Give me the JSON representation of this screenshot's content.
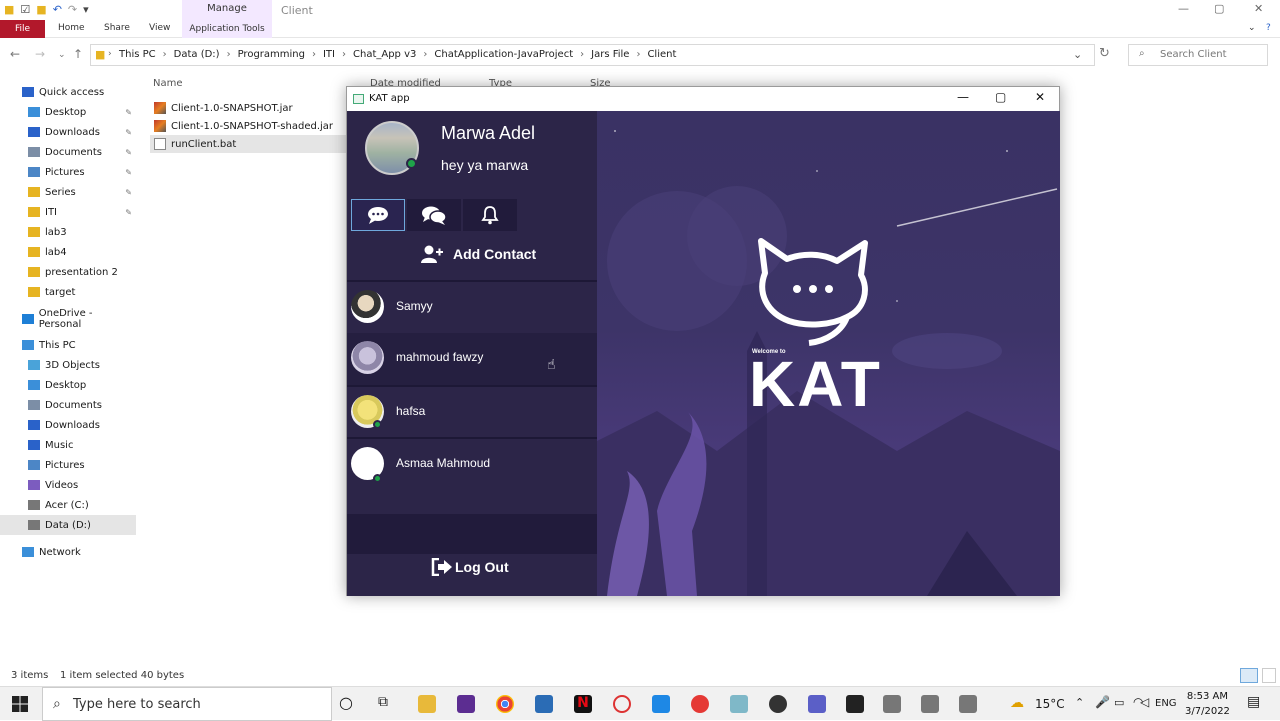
{
  "explorer": {
    "ribbon_context": "Manage",
    "window_title": "Client",
    "tabs": {
      "file": "File",
      "home": "Home",
      "share": "Share",
      "view": "View",
      "app_tools": "Application Tools"
    },
    "breadcrumbs": [
      "This PC",
      "Data (D:)",
      "Programming",
      "ITI",
      "Chat_App v3",
      "ChatApplication-JavaProject",
      "Jars File",
      "Client"
    ],
    "search_placeholder": "Search Client",
    "columns": {
      "name": "Name",
      "date": "Date modified",
      "type": "Type",
      "size": "Size"
    },
    "files": [
      {
        "name": "Client-1.0-SNAPSHOT.jar",
        "icon": "jar-file-icon"
      },
      {
        "name": "Client-1.0-SNAPSHOT-shaded.jar",
        "icon": "jar-file-icon"
      },
      {
        "name": "runClient.bat",
        "icon": "bat-file-icon",
        "selected": true
      }
    ],
    "sidebar": [
      {
        "label": "Quick access",
        "icon": "star-icon"
      },
      {
        "label": "Desktop",
        "icon": "desktop-icon",
        "pinned": true
      },
      {
        "label": "Downloads",
        "icon": "download-icon",
        "pinned": true
      },
      {
        "label": "Documents",
        "icon": "documents-icon",
        "pinned": true
      },
      {
        "label": "Pictures",
        "icon": "pictures-icon",
        "pinned": true
      },
      {
        "label": "Series",
        "icon": "folder-icon",
        "pinned": true
      },
      {
        "label": "ITI",
        "icon": "folder-icon",
        "pinned": true
      },
      {
        "label": "lab3",
        "icon": "folder-icon"
      },
      {
        "label": "lab4",
        "icon": "folder-icon"
      },
      {
        "label": "presentation 2",
        "icon": "folder-icon"
      },
      {
        "label": "target",
        "icon": "folder-icon"
      },
      {
        "label": "OneDrive - Personal",
        "icon": "cloud-icon"
      },
      {
        "label": "This PC",
        "icon": "computer-icon"
      },
      {
        "label": "3D Objects",
        "icon": "cube-icon"
      },
      {
        "label": "Desktop",
        "icon": "desktop-icon"
      },
      {
        "label": "Documents",
        "icon": "documents-icon"
      },
      {
        "label": "Downloads",
        "icon": "download-icon"
      },
      {
        "label": "Music",
        "icon": "music-icon"
      },
      {
        "label": "Pictures",
        "icon": "pictures-icon"
      },
      {
        "label": "Videos",
        "icon": "videos-icon"
      },
      {
        "label": "Acer (C:)",
        "icon": "drive-icon"
      },
      {
        "label": "Data (D:)",
        "icon": "drive-icon",
        "selected": true
      },
      {
        "label": "Network",
        "icon": "network-icon"
      }
    ],
    "status": {
      "items": "3 items",
      "selected": "1 item selected  40 bytes"
    }
  },
  "kat": {
    "window_title": "KAT app",
    "profile_name": "Marwa Adel",
    "profile_status": "hey ya marwa",
    "add_contact": "Add Contact",
    "contacts": [
      {
        "name": "Samyy",
        "online": false
      },
      {
        "name": "mahmoud fawzy",
        "online": false
      },
      {
        "name": "hafsa",
        "online": true
      },
      {
        "name": "Asmaa Mahmoud",
        "online": true
      }
    ],
    "logout": "Log Out",
    "welcome": "Welcome to",
    "brand": "KAT",
    "colors": {
      "sidebar": "#2c2548",
      "accent_online": "#1fa34a",
      "background": "#3d3468"
    }
  },
  "taskbar": {
    "search_placeholder": "Type here to search",
    "weather": "15°C",
    "language": "ENG",
    "time": "8:53 AM",
    "date": "3/7/2022"
  }
}
